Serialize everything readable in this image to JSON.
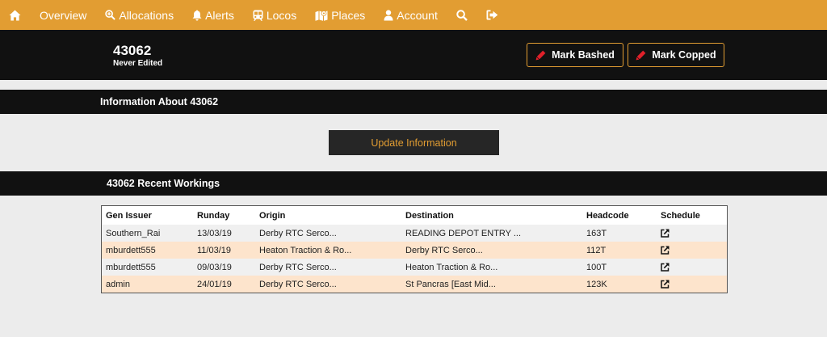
{
  "nav": {
    "items": [
      {
        "key": "home",
        "label": "",
        "icon": "home-icon"
      },
      {
        "key": "overview",
        "label": "Overview",
        "icon": ""
      },
      {
        "key": "allocations",
        "label": "Allocations",
        "icon": "search-plus-icon"
      },
      {
        "key": "alerts",
        "label": "Alerts",
        "icon": "bell-icon"
      },
      {
        "key": "locos",
        "label": "Locos",
        "icon": "train-icon"
      },
      {
        "key": "places",
        "label": "Places",
        "icon": "map-icon"
      },
      {
        "key": "account",
        "label": "Account",
        "icon": "user-icon"
      },
      {
        "key": "search",
        "label": "",
        "icon": "search-icon"
      },
      {
        "key": "logout",
        "label": "",
        "icon": "sign-out-icon"
      }
    ]
  },
  "header": {
    "loco_id": "43062",
    "edit_status": "Never Edited",
    "mark_bashed_label": "Mark Bashed",
    "mark_copped_label": "Mark Copped"
  },
  "info_section": {
    "title": "Information About 43062",
    "update_label": "Update Information"
  },
  "workings": {
    "title": "43062 Recent Workings",
    "columns": [
      "Gen Issuer",
      "Runday",
      "Origin",
      "Destination",
      "Headcode",
      "Schedule"
    ],
    "rows": [
      {
        "issuer": "Southern_Rai",
        "runday": "13/03/19",
        "origin": "Derby RTC Serco...",
        "destination": "READING DEPOT ENTRY ...",
        "headcode": "163T"
      },
      {
        "issuer": "mburdett555",
        "runday": "11/03/19",
        "origin": "Heaton Traction & Ro...",
        "destination": "Derby RTC Serco...",
        "headcode": "112T"
      },
      {
        "issuer": "mburdett555",
        "runday": "09/03/19",
        "origin": "Derby RTC Serco...",
        "destination": "Heaton Traction & Ro...",
        "headcode": "100T"
      },
      {
        "issuer": "admin",
        "runday": "24/01/19",
        "origin": "Derby RTC Serco...",
        "destination": "St Pancras [East Mid...",
        "headcode": "123K"
      }
    ]
  },
  "colors": {
    "accent": "#e29d32",
    "dark": "#111111",
    "row_peach": "#fde4cc",
    "row_grey": "#f0f0f0",
    "marker_red": "#e0202a"
  }
}
